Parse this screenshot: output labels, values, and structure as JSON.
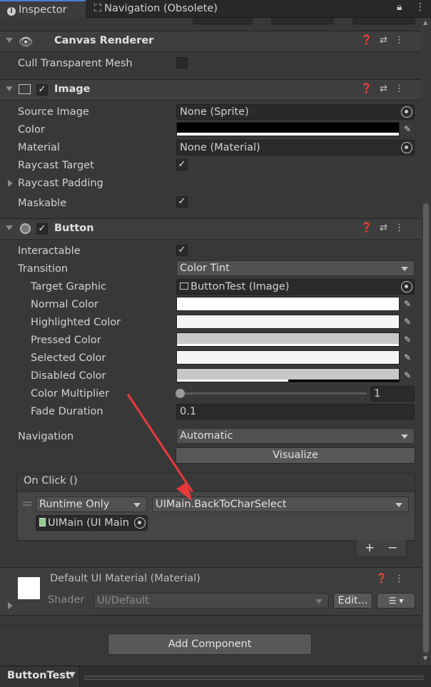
{
  "tabs": [
    {
      "label": "Inspector"
    },
    {
      "label": "Navigation (Obsolete)"
    }
  ],
  "canvas_renderer": {
    "title": "Canvas Renderer",
    "cull_label": "Cull Transparent Mesh"
  },
  "image": {
    "title": "Image",
    "source_image_label": "Source Image",
    "source_image_value": "None (Sprite)",
    "color_label": "Color",
    "material_label": "Material",
    "material_value": "None (Material)",
    "raycast_target_label": "Raycast Target",
    "raycast_padding_label": "Raycast Padding",
    "maskable_label": "Maskable"
  },
  "button": {
    "title": "Button",
    "interactable_label": "Interactable",
    "transition_label": "Transition",
    "transition_value": "Color Tint",
    "target_graphic_label": "Target Graphic",
    "target_graphic_value": "ButtonTest (Image)",
    "normal_color_label": "Normal Color",
    "highlighted_color_label": "Highlighted Color",
    "pressed_color_label": "Pressed Color",
    "selected_color_label": "Selected Color",
    "disabled_color_label": "Disabled Color",
    "color_multiplier_label": "Color Multiplier",
    "color_multiplier_value": "1",
    "fade_duration_label": "Fade Duration",
    "fade_duration_value": "0.1",
    "navigation_label": "Navigation",
    "navigation_value": "Automatic",
    "visualize_label": "Visualize",
    "on_click_label": "On Click ()",
    "runtime_value": "Runtime Only",
    "function_value": "UIMain.BackToCharSelect",
    "object_value": "UIMain (UI Main",
    "add_label": "+",
    "remove_label": "−"
  },
  "material_section": {
    "title": "Default UI Material (Material)",
    "shader_label": "Shader",
    "shader_value": "UI/Default",
    "edit_label": "Edit..."
  },
  "add_component_label": "Add Component",
  "footer_object_label": "ButtonTest",
  "colors": {
    "image_color": "#000000",
    "normal": "#ffffff",
    "highlighted": "#f5f5f5",
    "pressed": "#c8c8c8",
    "selected": "#f5f5f5",
    "disabled": "#c8c8c8",
    "arrow": "#e8383b"
  },
  "icons": [
    "info-icon",
    "navigation-icon",
    "lock-icon",
    "menu-icon",
    "eye-icon",
    "image-component-icon",
    "button-component-icon",
    "help-icon",
    "preset-icon",
    "kebab-icon",
    "object-picker-icon",
    "eyedropper-icon",
    "script-icon",
    "list-icon"
  ]
}
